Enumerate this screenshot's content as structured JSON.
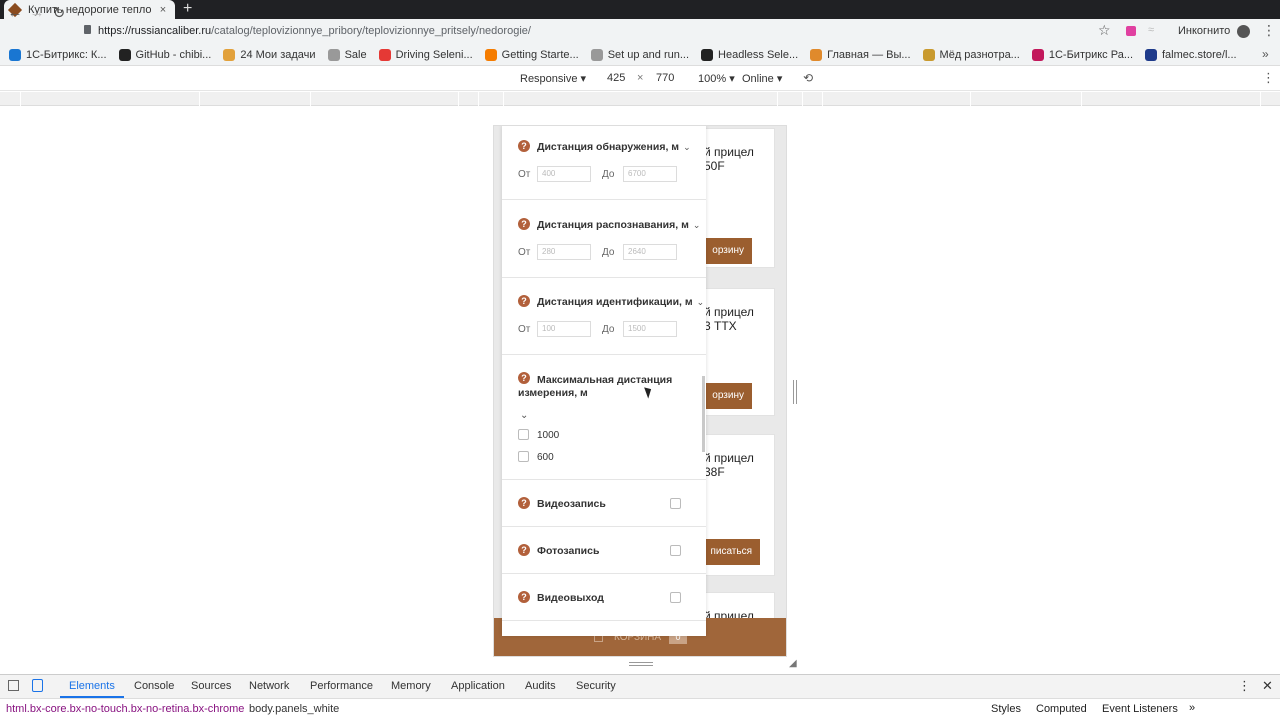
{
  "browser": {
    "tab_title": "Купить недорогие тепло",
    "tab_close": "×",
    "new_tab": "+",
    "url_host": "https://russiancaliber.ru",
    "url_path": "/catalog/teplovizionnye_pribory/teplovizionnye_pritsely/nedorogie/",
    "profile_label": "Инкогнито"
  },
  "bookmarks": [
    {
      "label": "1С-Битрикс: К...",
      "icon": "bitrix-icon",
      "color": "#1976d2"
    },
    {
      "label": "GitHub - chibi...",
      "icon": "github-icon",
      "color": "#222222"
    },
    {
      "label": "24  Мои задачи",
      "icon": "bitrix24-icon",
      "color": "#e2a13b"
    },
    {
      "label": "Sale",
      "icon": "page-icon",
      "color": "#999999"
    },
    {
      "label": "Driving Seleni...",
      "icon": "youtube-icon",
      "color": "#e53935"
    },
    {
      "label": "Getting Starte...",
      "icon": "docs-icon",
      "color": "#f57c00"
    },
    {
      "label": "Set up and run...",
      "icon": "page-icon",
      "color": "#999999"
    },
    {
      "label": "Headless Sele...",
      "icon": "github-icon",
      "color": "#222222"
    },
    {
      "label": "Главная — Вы...",
      "icon": "site-icon",
      "color": "#e08a2c"
    },
    {
      "label": "Мёд разнотра...",
      "icon": "honey-icon",
      "color": "#c99a2e"
    },
    {
      "label": "1С-Битрикс Ра...",
      "icon": "bitrix-icon",
      "color": "#c2185b"
    },
    {
      "label": "falmec.store/l...",
      "icon": "falmec-icon",
      "color": "#1e3a8a"
    }
  ],
  "device_toolbar": {
    "mode": "Responsive ▾",
    "width": "425",
    "times": "×",
    "height": "770",
    "zoom": "100% ▾",
    "network": "Online ▾"
  },
  "filters": [
    {
      "title": "Дистанция обнаружения, м",
      "from_label": "От",
      "to_label": "До",
      "from_placeholder": "400",
      "to_placeholder": "6700"
    },
    {
      "title": "Дистанция распознавания, м",
      "from_label": "От",
      "to_label": "До",
      "from_placeholder": "280",
      "to_placeholder": "2640"
    },
    {
      "title": "Дистанция идентификации, м",
      "from_label": "От",
      "to_label": "До",
      "from_placeholder": "100",
      "to_placeholder": "1500"
    },
    {
      "title_line1": "Максимальная дистанция",
      "title_line2": "измерения, м",
      "options": [
        "1000",
        "600"
      ]
    },
    {
      "title": "Видеозапись"
    },
    {
      "title": "Фотозапись"
    },
    {
      "title": "Видеовыход"
    }
  ],
  "help_mark": "?",
  "products": [
    {
      "name_line1": "й прицел",
      "name_line2": "50F",
      "button": "орзину"
    },
    {
      "name_line1": "й прицел",
      "name_line2": "3 TTX",
      "button": "орзину"
    },
    {
      "name_line1": "й прицел",
      "name_line2": "38F",
      "button": "писаться"
    },
    {
      "name_line1": "й прицел",
      "name_line2": ""
    }
  ],
  "cart": {
    "label": "КОРЗИНА",
    "count": "0"
  },
  "devtools": {
    "tabs": [
      "Elements",
      "Console",
      "Sources",
      "Network",
      "Performance",
      "Memory",
      "Application",
      "Audits",
      "Security"
    ],
    "more": "»",
    "breadcrumb_1": "html.bx-core.bx-no-touch.bx-no-retina.bx-chrome",
    "breadcrumb_2": "body.panels_white",
    "side_tabs": [
      "Styles",
      "Computed",
      "Event Listeners"
    ]
  }
}
